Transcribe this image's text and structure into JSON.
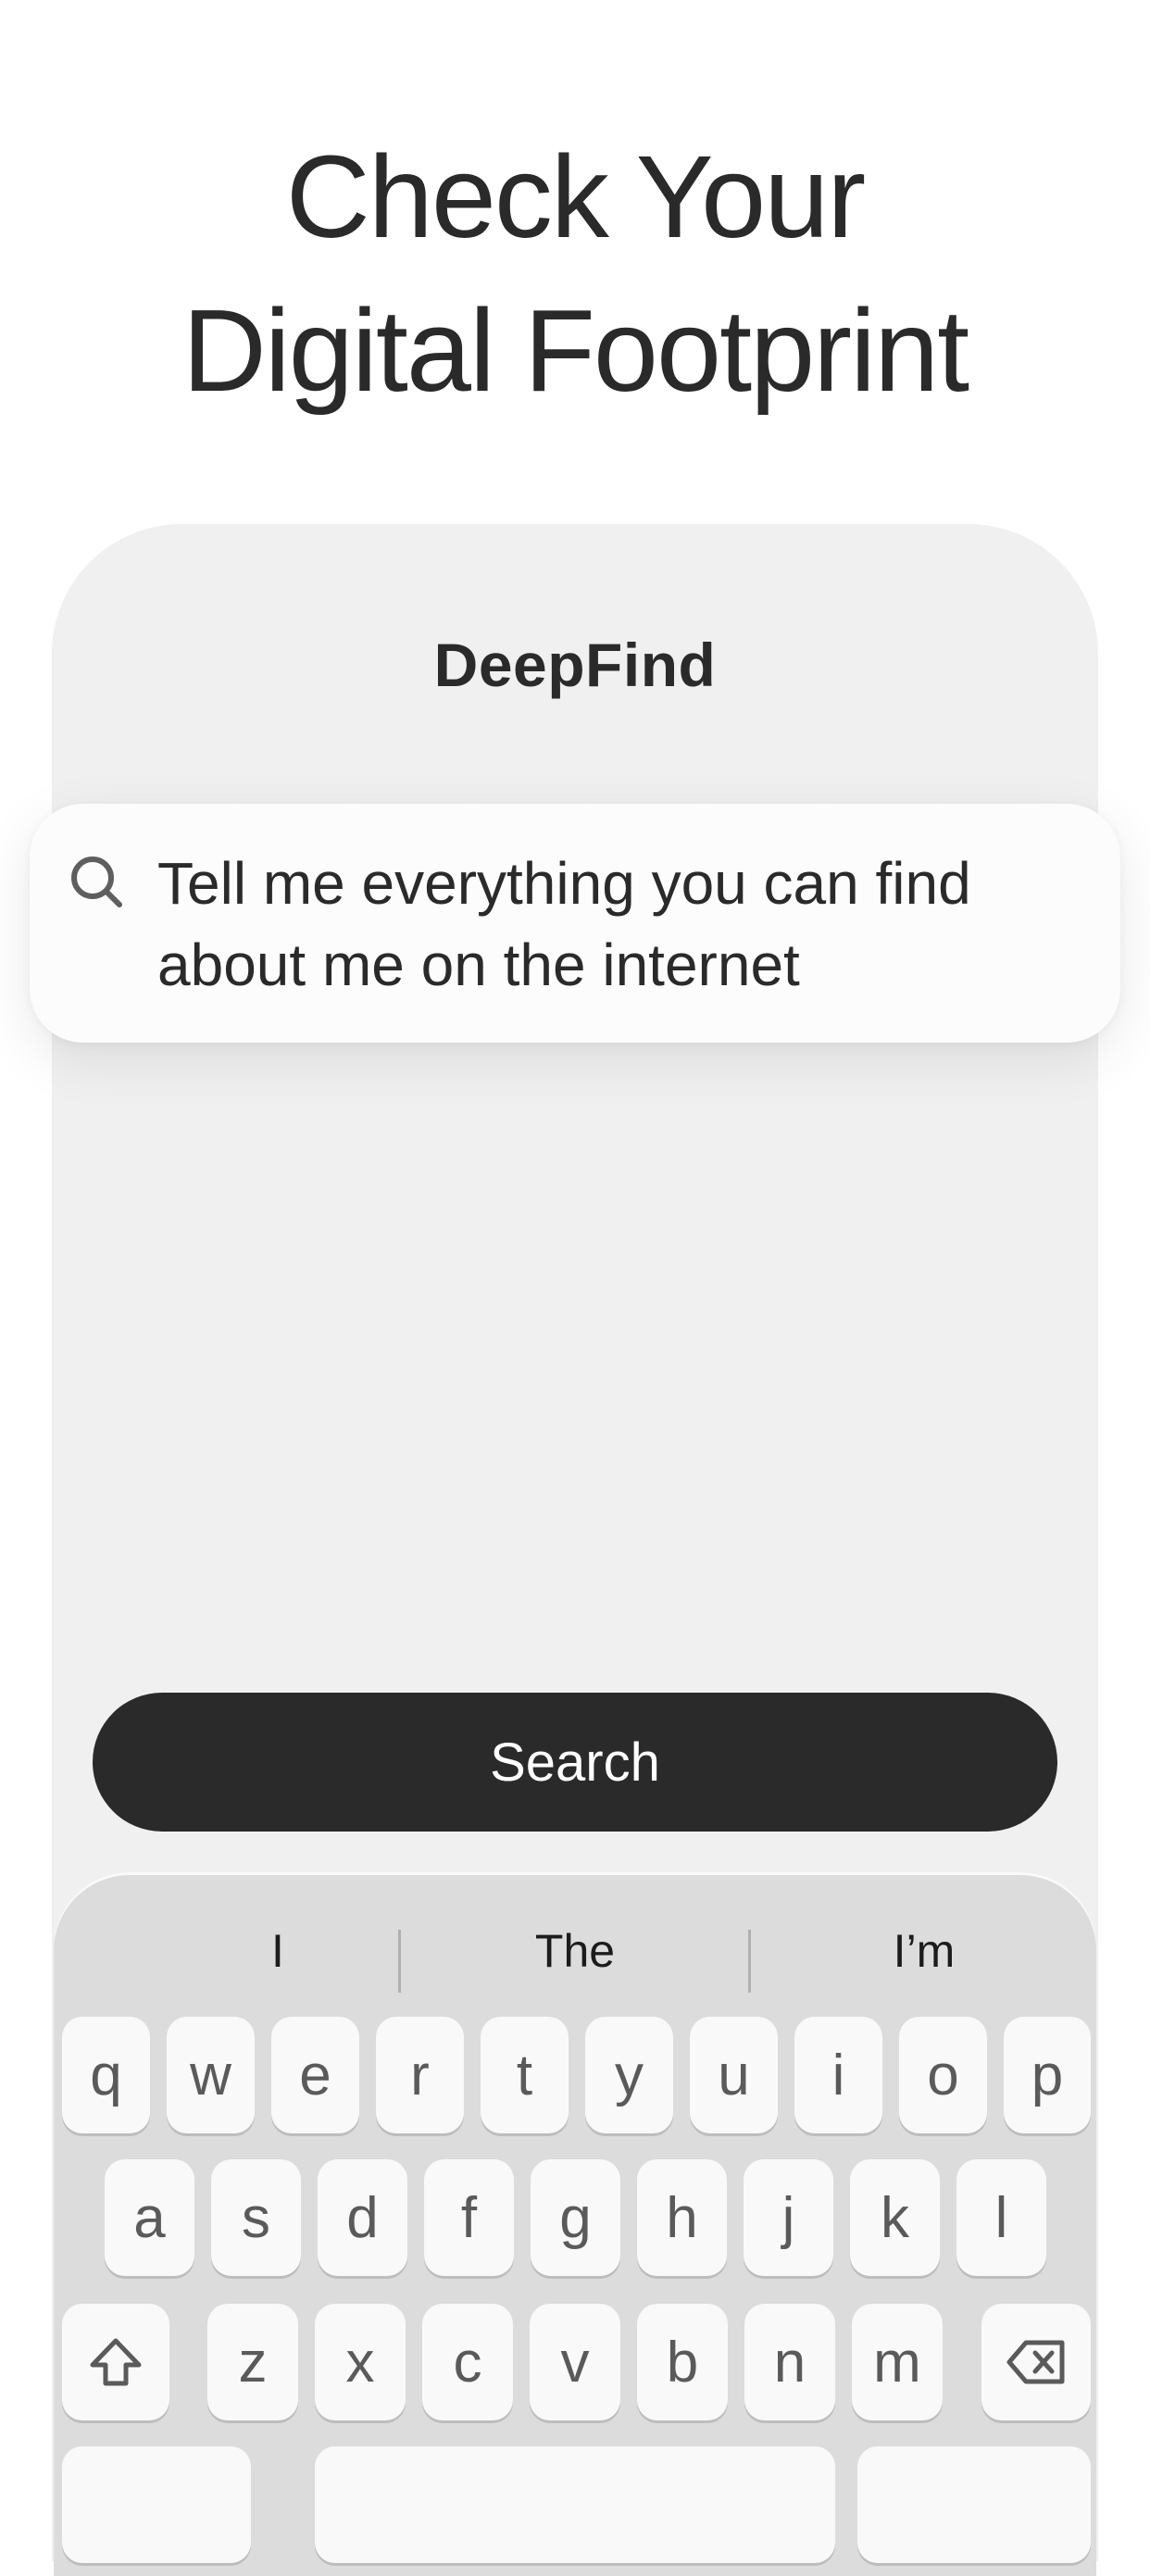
{
  "headline": {
    "line1": "Check Your",
    "line2": "Digital Footprint"
  },
  "app": {
    "name": "DeepFind"
  },
  "search": {
    "query": "Tell me everything you can find about me on the internet",
    "icon": "search-icon"
  },
  "search_button": {
    "label": "Search"
  },
  "keyboard": {
    "suggestions": [
      "I",
      "The",
      "I’m"
    ],
    "row1": [
      "q",
      "w",
      "e",
      "r",
      "t",
      "y",
      "u",
      "i",
      "o",
      "p"
    ],
    "row2": [
      "a",
      "s",
      "d",
      "f",
      "g",
      "h",
      "j",
      "k",
      "l"
    ],
    "row3": [
      "z",
      "x",
      "c",
      "v",
      "b",
      "n",
      "m"
    ],
    "shift_icon": "shift-icon",
    "backspace_icon": "backspace-icon"
  },
  "colors": {
    "dark": "#2a2a2a",
    "panel": "#f0f0f0",
    "keyboard": "#dcdcdc",
    "key": "#f9f9f9"
  }
}
